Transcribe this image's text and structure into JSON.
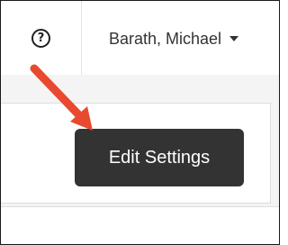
{
  "header": {
    "help_icon_symbol": "?",
    "user_name": "Barath, Michael"
  },
  "tooltip": {
    "text": "Edit Settings"
  },
  "annotation": {
    "arrow_color": "#e8492f"
  }
}
